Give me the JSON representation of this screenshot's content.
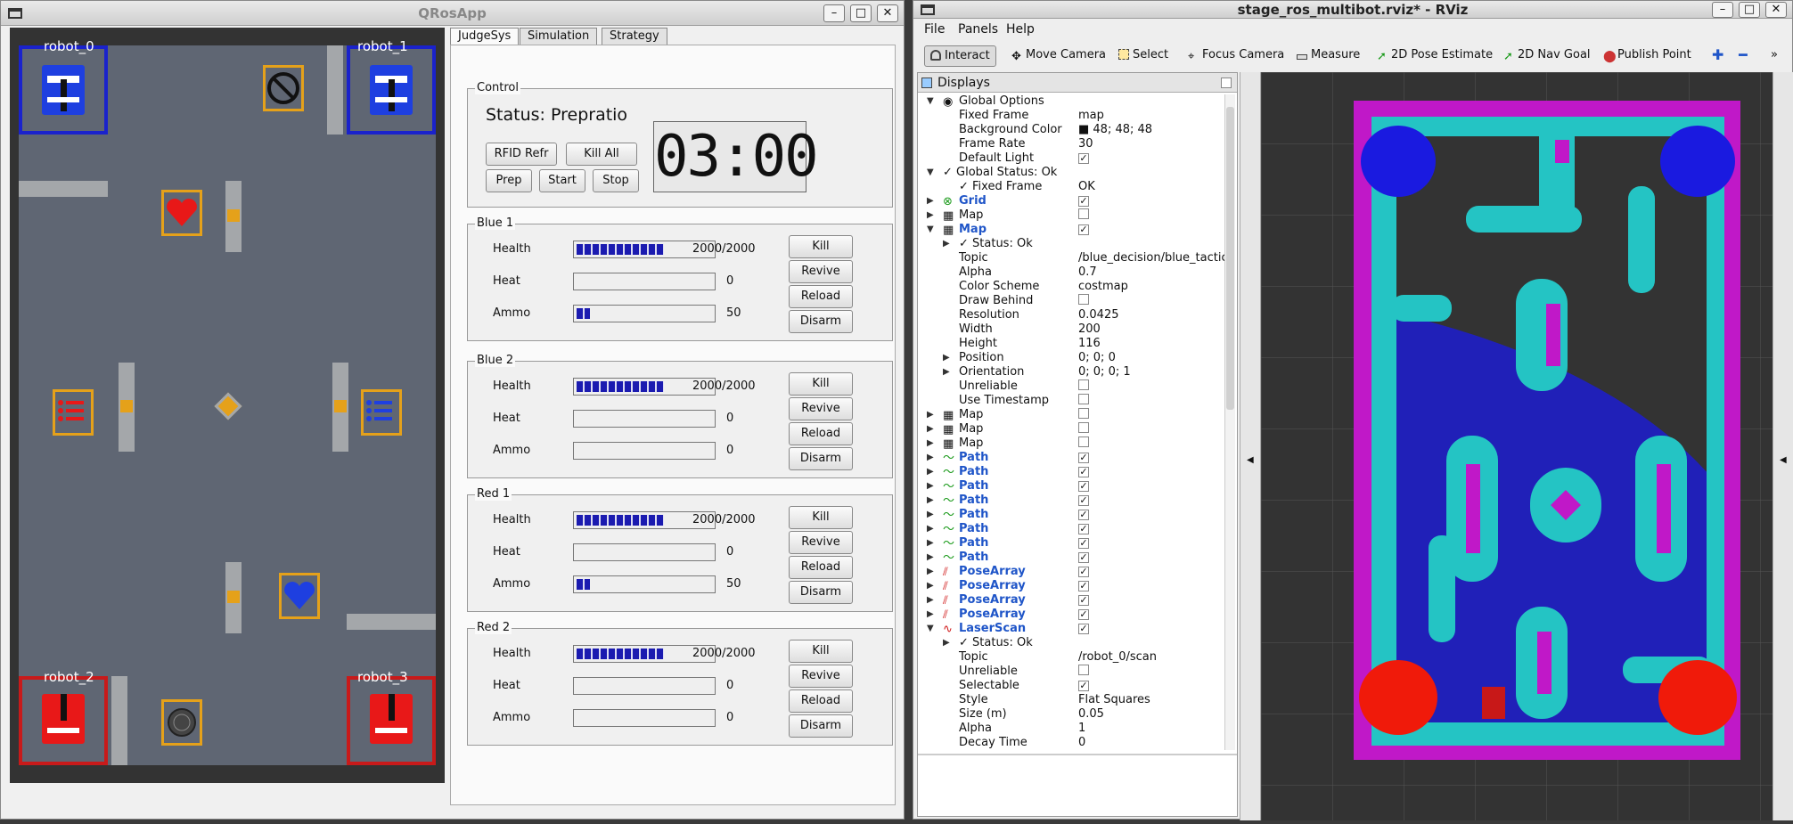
{
  "qros": {
    "title": "QRosApp",
    "controls": {
      "min": "–",
      "max": "□",
      "close": "✕"
    },
    "robots": [
      "robot_0",
      "robot_1",
      "robot_2",
      "robot_3"
    ],
    "tabs": [
      "JudgeSys",
      "Simulation",
      "Strategy"
    ],
    "control": {
      "title": "Control",
      "status": "Status: Prepratio",
      "timer": "03:00",
      "buttons": [
        "RFID Refr",
        "Kill All",
        "Prep",
        "Start",
        "Stop"
      ]
    },
    "labels": {
      "health": "Health",
      "heat": "Heat",
      "ammo": "Ammo"
    },
    "actions": [
      "Kill",
      "Revive",
      "Reload",
      "Disarm"
    ],
    "teams": [
      {
        "name": "Blue 1",
        "health": "2000/2000",
        "health_frac": 1.0,
        "heat": "0",
        "heat_frac": 0.0,
        "ammo": "50",
        "ammo_frac": 0.15
      },
      {
        "name": "Blue 2",
        "health": "2000/2000",
        "health_frac": 1.0,
        "heat": "0",
        "heat_frac": 0.0,
        "ammo": "0",
        "ammo_frac": 0.0
      },
      {
        "name": "Red 1",
        "health": "2000/2000",
        "health_frac": 1.0,
        "heat": "0",
        "heat_frac": 0.0,
        "ammo": "50",
        "ammo_frac": 0.15
      },
      {
        "name": "Red 2",
        "health": "2000/2000",
        "health_frac": 1.0,
        "heat": "0",
        "heat_frac": 0.0,
        "ammo": "0",
        "ammo_frac": 0.0
      }
    ]
  },
  "rviz": {
    "title": "stage_ros_multibot.rviz* - RViz",
    "menus": [
      "File",
      "Panels",
      "Help"
    ],
    "tools": [
      "Interact",
      "Move Camera",
      "Select",
      "Focus Camera",
      "Measure",
      "2D Pose Estimate",
      "2D Nav Goal",
      "Publish Point"
    ],
    "displays_title": "Displays",
    "tree": [
      {
        "name": "Global Options",
        "value": "",
        "indent": 0,
        "arrow": "▾",
        "kind": "plain",
        "icon": "globe-icon"
      },
      {
        "name": "Fixed Frame",
        "value": "map",
        "indent": 1
      },
      {
        "name": "Background Color",
        "value": "■ 48; 48; 48",
        "indent": 1
      },
      {
        "name": "Frame Rate",
        "value": "30",
        "indent": 1
      },
      {
        "name": "Default Light",
        "value": "✓",
        "check": true,
        "indent": 1
      },
      {
        "name": "✓ Global Status: Ok",
        "value": "",
        "indent": 0,
        "arrow": "▾",
        "kind": "plain"
      },
      {
        "name": "✓ Fixed Frame",
        "value": "OK",
        "indent": 1
      },
      {
        "name": "Grid",
        "value": "✓",
        "check": true,
        "indent": 0,
        "arrow": "▸",
        "kind": "blue",
        "icon": "grid-icon"
      },
      {
        "name": "Map",
        "value": "",
        "check": true,
        "indent": 0,
        "arrow": "▸",
        "kind": "plain",
        "icon": "map-icon"
      },
      {
        "name": "Map",
        "value": "✓",
        "check": true,
        "indent": 0,
        "arrow": "▾",
        "kind": "blue",
        "icon": "map-icon"
      },
      {
        "name": "✓ Status: Ok",
        "value": "",
        "indent": 1,
        "arrow": "▸"
      },
      {
        "name": "Topic",
        "value": "/blue_decision/blue_tactic_",
        "indent": 1
      },
      {
        "name": "Alpha",
        "value": "0.7",
        "indent": 1
      },
      {
        "name": "Color Scheme",
        "value": "costmap",
        "indent": 1
      },
      {
        "name": "Draw Behind",
        "value": "",
        "check": true,
        "indent": 1
      },
      {
        "name": "Resolution",
        "value": "0.0425",
        "indent": 1
      },
      {
        "name": "Width",
        "value": "200",
        "indent": 1
      },
      {
        "name": "Height",
        "value": "116",
        "indent": 1
      },
      {
        "name": "Position",
        "value": "0; 0; 0",
        "indent": 1,
        "arrow": "▸"
      },
      {
        "name": "Orientation",
        "value": "0; 0; 0; 1",
        "indent": 1,
        "arrow": "▸"
      },
      {
        "name": "Unreliable",
        "value": "",
        "check": true,
        "indent": 1
      },
      {
        "name": "Use Timestamp",
        "value": "",
        "check": true,
        "indent": 1
      },
      {
        "name": "Map",
        "value": "",
        "check": true,
        "indent": 0,
        "arrow": "▸",
        "kind": "plain",
        "icon": "map-icon"
      },
      {
        "name": "Map",
        "value": "",
        "check": true,
        "indent": 0,
        "arrow": "▸",
        "kind": "plain",
        "icon": "map-icon"
      },
      {
        "name": "Map",
        "value": "",
        "check": true,
        "indent": 0,
        "arrow": "▸",
        "kind": "plain",
        "icon": "map-icon"
      },
      {
        "name": "Path",
        "value": "✓",
        "check": true,
        "indent": 0,
        "arrow": "▸",
        "kind": "blue",
        "icon": "path-icon"
      },
      {
        "name": "Path",
        "value": "✓",
        "check": true,
        "indent": 0,
        "arrow": "▸",
        "kind": "blue",
        "icon": "path-icon"
      },
      {
        "name": "Path",
        "value": "✓",
        "check": true,
        "indent": 0,
        "arrow": "▸",
        "kind": "blue",
        "icon": "path-icon"
      },
      {
        "name": "Path",
        "value": "✓",
        "check": true,
        "indent": 0,
        "arrow": "▸",
        "kind": "blue",
        "icon": "path-icon"
      },
      {
        "name": "Path",
        "value": "✓",
        "check": true,
        "indent": 0,
        "arrow": "▸",
        "kind": "blue",
        "icon": "path-icon"
      },
      {
        "name": "Path",
        "value": "✓",
        "check": true,
        "indent": 0,
        "arrow": "▸",
        "kind": "blue",
        "icon": "path-icon"
      },
      {
        "name": "Path",
        "value": "✓",
        "check": true,
        "indent": 0,
        "arrow": "▸",
        "kind": "blue",
        "icon": "path-icon"
      },
      {
        "name": "Path",
        "value": "✓",
        "check": true,
        "indent": 0,
        "arrow": "▸",
        "kind": "blue",
        "icon": "path-icon"
      },
      {
        "name": "PoseArray",
        "value": "✓",
        "check": true,
        "indent": 0,
        "arrow": "▸",
        "kind": "blue",
        "icon": "posearray-icon"
      },
      {
        "name": "PoseArray",
        "value": "✓",
        "check": true,
        "indent": 0,
        "arrow": "▸",
        "kind": "blue",
        "icon": "posearray-icon"
      },
      {
        "name": "PoseArray",
        "value": "✓",
        "check": true,
        "indent": 0,
        "arrow": "▸",
        "kind": "blue",
        "icon": "posearray-icon"
      },
      {
        "name": "PoseArray",
        "value": "✓",
        "check": true,
        "indent": 0,
        "arrow": "▸",
        "kind": "blue",
        "icon": "posearray-icon"
      },
      {
        "name": "LaserScan",
        "value": "✓",
        "check": true,
        "indent": 0,
        "arrow": "▾",
        "kind": "blue",
        "icon": "laserscan-icon"
      },
      {
        "name": "✓ Status: Ok",
        "value": "",
        "indent": 1,
        "arrow": "▸"
      },
      {
        "name": "Topic",
        "value": "/robot_0/scan",
        "indent": 1
      },
      {
        "name": "Unreliable",
        "value": "",
        "check": true,
        "indent": 1
      },
      {
        "name": "Selectable",
        "value": "✓",
        "check": true,
        "indent": 1
      },
      {
        "name": "Style",
        "value": "Flat Squares",
        "indent": 1
      },
      {
        "name": "Size (m)",
        "value": "0.05",
        "indent": 1
      },
      {
        "name": "Alpha",
        "value": "1",
        "indent": 1
      },
      {
        "name": "Decay Time",
        "value": "0",
        "indent": 1
      }
    ]
  }
}
